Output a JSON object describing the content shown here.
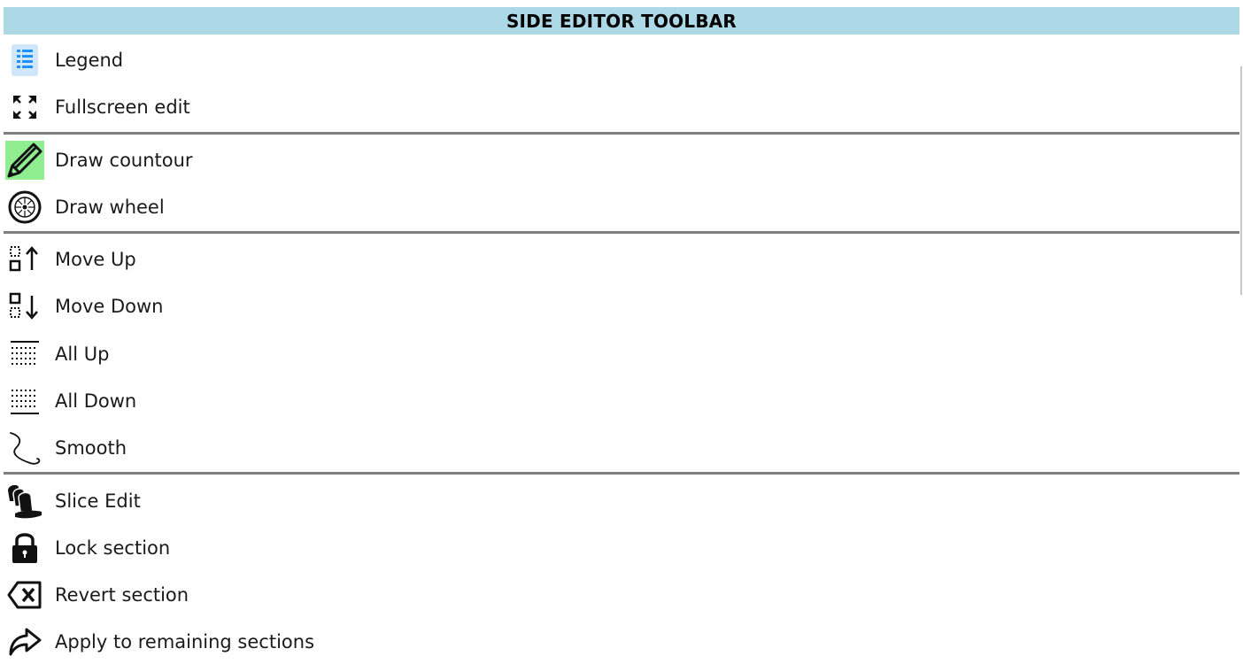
{
  "toolbar": {
    "title": "SIDE EDITOR TOOLBAR",
    "accent_color": "#add8e6",
    "separator_color": "#7f7f7f",
    "items": [
      {
        "label": "Legend",
        "icon": "list-icon",
        "active": false
      },
      {
        "label": "Fullscreen edit",
        "icon": "fullscreen-icon",
        "active": false
      },
      {
        "label": "Draw countour",
        "icon": "pencil-icon",
        "active": true,
        "active_color": "#90ee90"
      },
      {
        "label": "Draw wheel",
        "icon": "wheel-icon",
        "active": false
      },
      {
        "label": "Move Up",
        "icon": "move-up-icon",
        "active": false
      },
      {
        "label": "Move Down",
        "icon": "move-down-icon",
        "active": false
      },
      {
        "label": "All Up",
        "icon": "all-up-icon",
        "active": false
      },
      {
        "label": "All Down",
        "icon": "all-down-icon",
        "active": false
      },
      {
        "label": "Smooth",
        "icon": "smooth-curve-icon",
        "active": false
      },
      {
        "label": "Slice Edit",
        "icon": "bread-slice-icon",
        "active": false
      },
      {
        "label": "Lock section",
        "icon": "lock-icon",
        "active": false
      },
      {
        "label": "Revert section",
        "icon": "backspace-x-icon",
        "active": false
      },
      {
        "label": "Apply to remaining sections",
        "icon": "forward-arrow-icon",
        "active": false
      }
    ]
  }
}
